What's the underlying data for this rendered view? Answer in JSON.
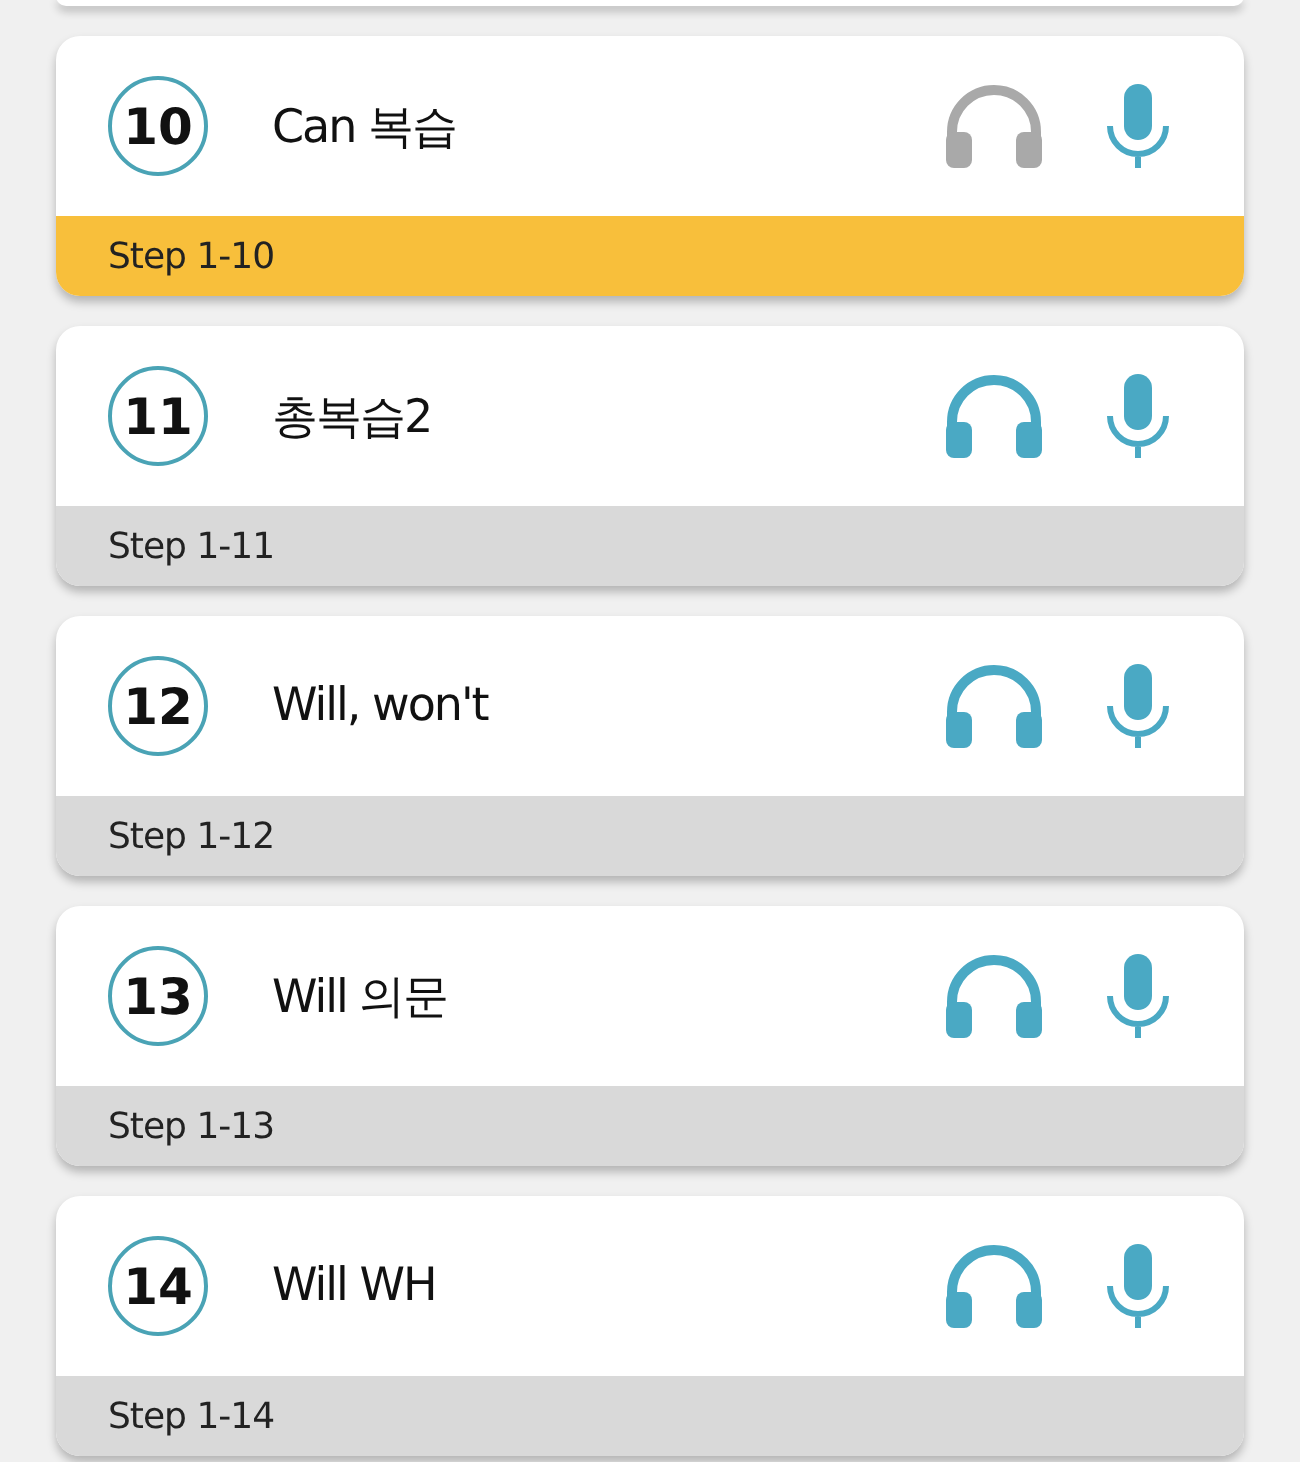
{
  "lessons": [
    {
      "number": "10",
      "title": "Can 복습",
      "step": "Step 1-10",
      "selected": true,
      "listen_enabled": false
    },
    {
      "number": "11",
      "title": "총복습2",
      "step": "Step 1-11",
      "selected": false,
      "listen_enabled": true
    },
    {
      "number": "12",
      "title": "Will, won't",
      "step": "Step 1-12",
      "selected": false,
      "listen_enabled": true
    },
    {
      "number": "13",
      "title": "Will 의문",
      "step": "Step 1-13",
      "selected": false,
      "listen_enabled": true
    },
    {
      "number": "14",
      "title": "Will WH",
      "step": "Step 1-14",
      "selected": false,
      "listen_enabled": true
    }
  ]
}
